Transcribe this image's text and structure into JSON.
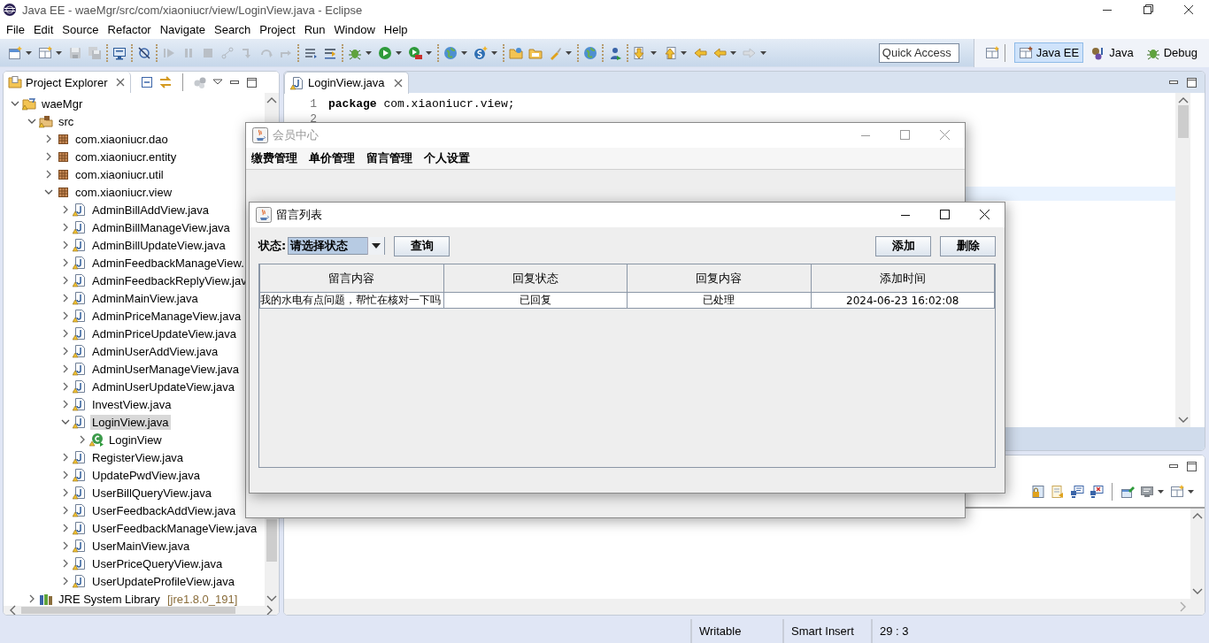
{
  "window": {
    "title": "Java EE - waeMgr/src/com/xiaoniucr/view/LoginView.java - Eclipse"
  },
  "menu": [
    "File",
    "Edit",
    "Source",
    "Refactor",
    "Navigate",
    "Search",
    "Project",
    "Run",
    "Window",
    "Help"
  ],
  "quick_access": {
    "placeholder": "Quick Access"
  },
  "perspectives": [
    {
      "label": "Java EE",
      "selected": true
    },
    {
      "label": "Java",
      "selected": false
    },
    {
      "label": "Debug",
      "selected": false
    }
  ],
  "project_explorer": {
    "title": "Project Explorer",
    "tree": [
      {
        "label": "waeMgr",
        "kind": "project",
        "expanded": true,
        "selected": false,
        "children": [
          {
            "label": "src",
            "kind": "source-folder",
            "expanded": true,
            "selected": false,
            "children": [
              {
                "label": "com.xiaoniucr.dao",
                "kind": "package",
                "expanded": false,
                "selected": false
              },
              {
                "label": "com.xiaoniucr.entity",
                "kind": "package",
                "expanded": false,
                "selected": false
              },
              {
                "label": "com.xiaoniucr.util",
                "kind": "package",
                "expanded": false,
                "selected": false
              },
              {
                "label": "com.xiaoniucr.view",
                "kind": "package",
                "expanded": true,
                "selected": false,
                "children": [
                  {
                    "label": "AdminBillAddView.java",
                    "kind": "java",
                    "expanded": false,
                    "selected": false
                  },
                  {
                    "label": "AdminBillManageView.java",
                    "kind": "java",
                    "expanded": false,
                    "selected": false
                  },
                  {
                    "label": "AdminBillUpdateView.java",
                    "kind": "java",
                    "expanded": false,
                    "selected": false
                  },
                  {
                    "label": "AdminFeedbackManageView.",
                    "kind": "java",
                    "expanded": false,
                    "selected": false
                  },
                  {
                    "label": "AdminFeedbackReplyView.jav",
                    "kind": "java",
                    "expanded": false,
                    "selected": false
                  },
                  {
                    "label": "AdminMainView.java",
                    "kind": "java",
                    "expanded": false,
                    "selected": false
                  },
                  {
                    "label": "AdminPriceManageView.java",
                    "kind": "java",
                    "expanded": false,
                    "selected": false
                  },
                  {
                    "label": "AdminPriceUpdateView.java",
                    "kind": "java",
                    "expanded": false,
                    "selected": false
                  },
                  {
                    "label": "AdminUserAddView.java",
                    "kind": "java",
                    "expanded": false,
                    "selected": false
                  },
                  {
                    "label": "AdminUserManageView.java",
                    "kind": "java",
                    "expanded": false,
                    "selected": false
                  },
                  {
                    "label": "AdminUserUpdateView.java",
                    "kind": "java",
                    "expanded": false,
                    "selected": false
                  },
                  {
                    "label": "InvestView.java",
                    "kind": "java",
                    "expanded": false,
                    "selected": false
                  },
                  {
                    "label": "LoginView.java",
                    "kind": "java",
                    "expanded": true,
                    "selected": true,
                    "children": [
                      {
                        "label": "LoginView",
                        "kind": "class",
                        "expanded": false,
                        "selected": false
                      }
                    ]
                  },
                  {
                    "label": "RegisterView.java",
                    "kind": "java",
                    "expanded": false,
                    "selected": false
                  },
                  {
                    "label": "UpdatePwdView.java",
                    "kind": "java",
                    "expanded": false,
                    "selected": false
                  },
                  {
                    "label": "UserBillQueryView.java",
                    "kind": "java",
                    "expanded": false,
                    "selected": false
                  },
                  {
                    "label": "UserFeedbackAddView.java",
                    "kind": "java",
                    "expanded": false,
                    "selected": false
                  },
                  {
                    "label": "UserFeedbackManageView.java",
                    "kind": "java",
                    "expanded": false,
                    "selected": false
                  },
                  {
                    "label": "UserMainView.java",
                    "kind": "java",
                    "expanded": false,
                    "selected": false
                  },
                  {
                    "label": "UserPriceQueryView.java",
                    "kind": "java",
                    "expanded": false,
                    "selected": false
                  },
                  {
                    "label": "UserUpdateProfileView.java",
                    "kind": "java",
                    "expanded": false,
                    "selected": false
                  }
                ]
              }
            ]
          },
          {
            "label": "JRE System Library",
            "detail": "[jre1.8.0_191]",
            "kind": "library",
            "expanded": false,
            "selected": false
          }
        ]
      }
    ]
  },
  "editor": {
    "tabs": [
      {
        "label": "LoginView.java",
        "selected": true
      }
    ],
    "lines": [
      {
        "number": "1",
        "code": "**package** com.xiaoniucr.view;"
      },
      {
        "number": "2"
      }
    ]
  },
  "status_bar": [
    "Writable",
    "Smart Insert",
    "29 : 3"
  ],
  "member_window": {
    "title": "会员中心",
    "active": false,
    "menu": [
      "缴费管理",
      "单价管理",
      "留言管理",
      "个人设置"
    ]
  },
  "feedback_window": {
    "title": "留言列表",
    "active": true,
    "filter": {
      "label": "状态:",
      "value": "请选择状态"
    },
    "query_button": "查询",
    "actions": [
      "添加",
      "删除"
    ],
    "table": {
      "columns": [
        "留言内容",
        "回复状态",
        "回复内容",
        "添加时间"
      ],
      "rows": [
        [
          "我的水电有点问题，帮忙在核对一下吗",
          "已回复",
          "已处理",
          "2024-06-23 16:02:08"
        ]
      ]
    }
  }
}
